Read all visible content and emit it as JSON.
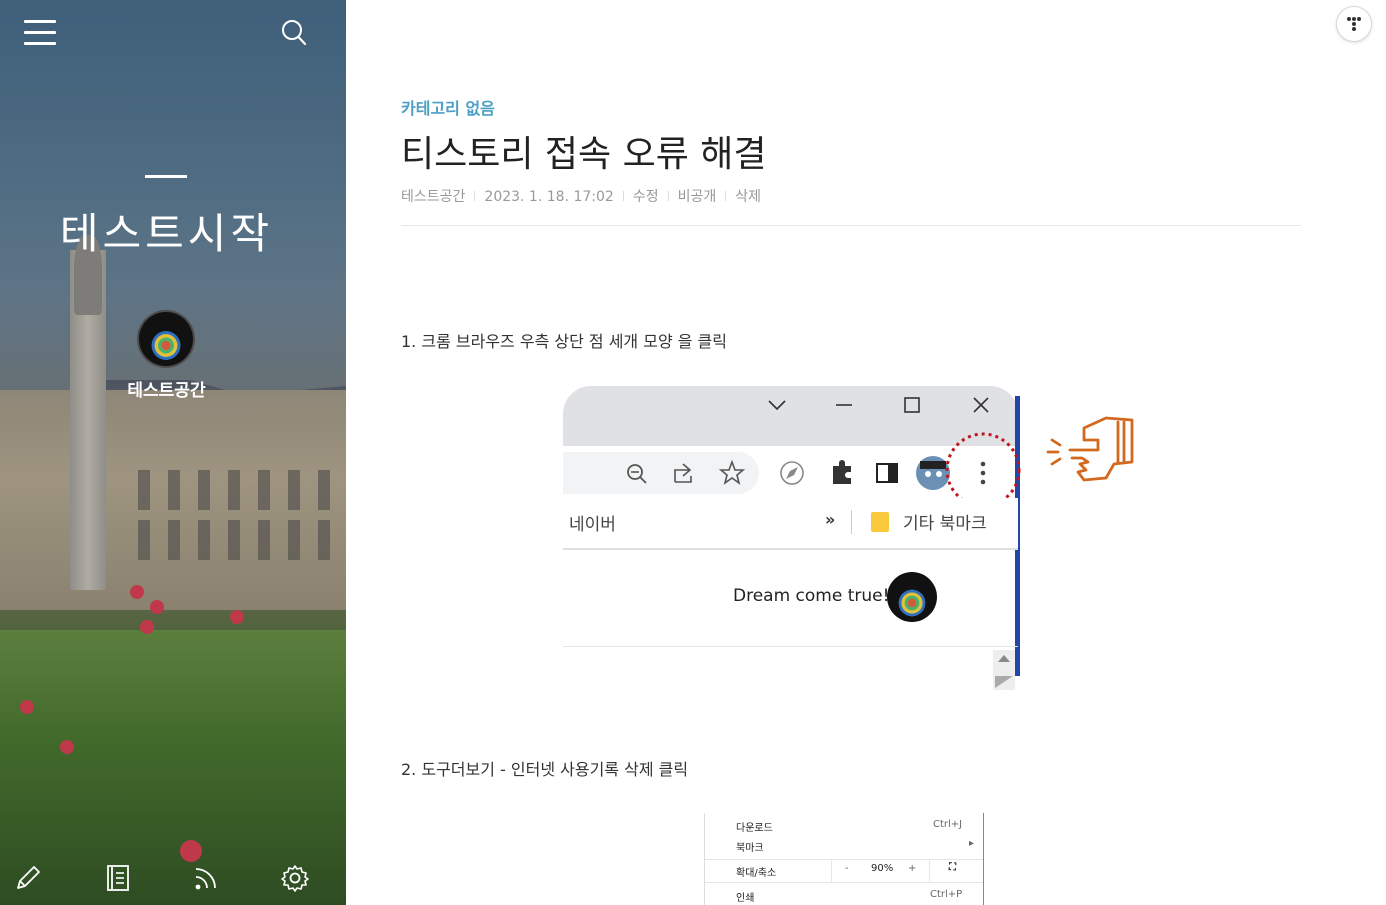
{
  "sidebar": {
    "blog_title": "테스트시작",
    "author_name": "테스트공간",
    "icons": {
      "menu": "hamburger-menu-icon",
      "search": "search-icon",
      "write": "pencil-icon",
      "guestbook": "book-icon",
      "rss": "rss-icon",
      "settings": "gear-icon"
    }
  },
  "post": {
    "category": "카테고리 없음",
    "title": "티스토리 접속 오류 해결",
    "meta": {
      "author": "테스트공간",
      "date": "2023. 1. 18. 17:02",
      "edit": "수정",
      "visibility": "비공개",
      "delete": "삭제"
    },
    "step1": "1. 크롬 브라우즈 우측 상단 점 세개 모양 을 클릭",
    "step2": "2. 도구더보기 - 인터넷 사용기록 삭제  클릭"
  },
  "screenshot1": {
    "bookmark_naver": "네이버",
    "bookmark_more": "»",
    "bookmark_other": "기타 북마크",
    "new_tab_text": "Dream come true!"
  },
  "screenshot2": {
    "downloads": "다운로드",
    "downloads_shortcut": "Ctrl+J",
    "bookmarks": "북마크",
    "zoom": "확대/축소",
    "zoom_minus": "-",
    "zoom_value": "90%",
    "zoom_plus": "+",
    "print": "인쇄",
    "print_shortcut": "Ctrl+P"
  },
  "colors": {
    "category": "#4b9fc4",
    "highlight_circle": "#c0141e",
    "hand": "#d2691e"
  }
}
